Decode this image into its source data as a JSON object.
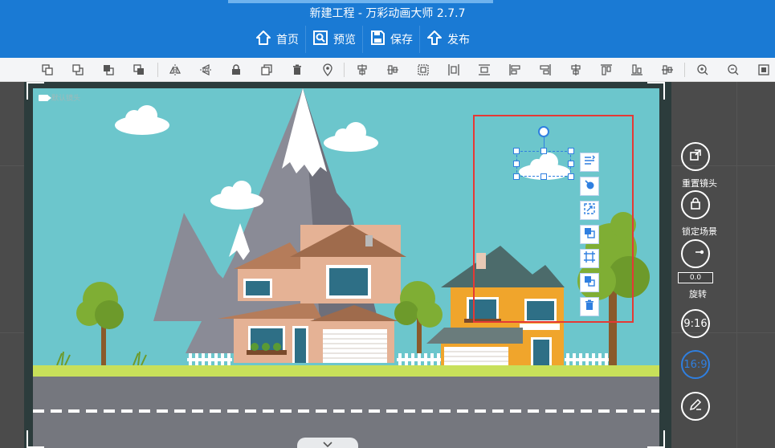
{
  "app": {
    "title": "新建工程 - 万彩动画大师 2.7.7"
  },
  "main_menu": [
    {
      "label": "首页",
      "icon": "home-icon"
    },
    {
      "label": "预览",
      "icon": "preview-icon"
    },
    {
      "label": "保存",
      "icon": "save-icon"
    },
    {
      "label": "发布",
      "icon": "publish-icon"
    }
  ],
  "canvas": {
    "camera_label": "默认镜头",
    "sky_color": "#6cc6cc",
    "grass_color": "#c8e05a",
    "road_color": "#75777e"
  },
  "selection": {
    "frame_color": "#e53935",
    "handle_color": "#2f7fe0"
  },
  "right_panel": {
    "reset_camera": "重置镜头",
    "lock_scene": "锁定场景",
    "rotate": "旋转",
    "rotate_value": "0.0",
    "ratio_916": "9:16",
    "ratio_169": "16:9",
    "ratio_active_color": "#2f7fe0"
  },
  "colors": {
    "brand": "#1a7ad4"
  }
}
